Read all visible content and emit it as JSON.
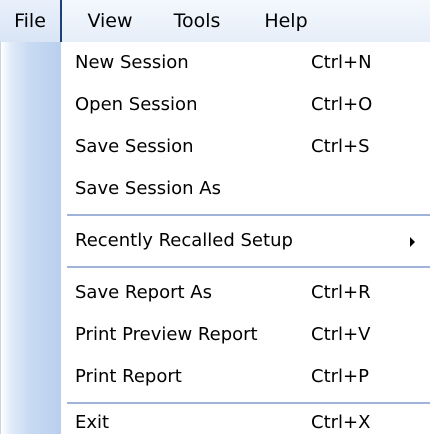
{
  "menubar": {
    "file": "File",
    "view": "View",
    "tools": "Tools",
    "help": "Help"
  },
  "file_menu": {
    "new_session": {
      "label": "New Session",
      "shortcut": "Ctrl+N"
    },
    "open_session": {
      "label": "Open Session",
      "shortcut": "Ctrl+O"
    },
    "save_session": {
      "label": "Save Session",
      "shortcut": "Ctrl+S"
    },
    "save_session_as": {
      "label": "Save Session As"
    },
    "recently_recalled_setup": {
      "label": "Recently Recalled Setup"
    },
    "save_report_as": {
      "label": "Save Report As",
      "shortcut": "Ctrl+R"
    },
    "print_preview_report": {
      "label": "Print Preview Report",
      "shortcut": "Ctrl+V"
    },
    "print_report": {
      "label": "Print Report",
      "shortcut": "Ctrl+P"
    },
    "exit": {
      "label": "Exit",
      "shortcut": "Ctrl+X"
    }
  }
}
